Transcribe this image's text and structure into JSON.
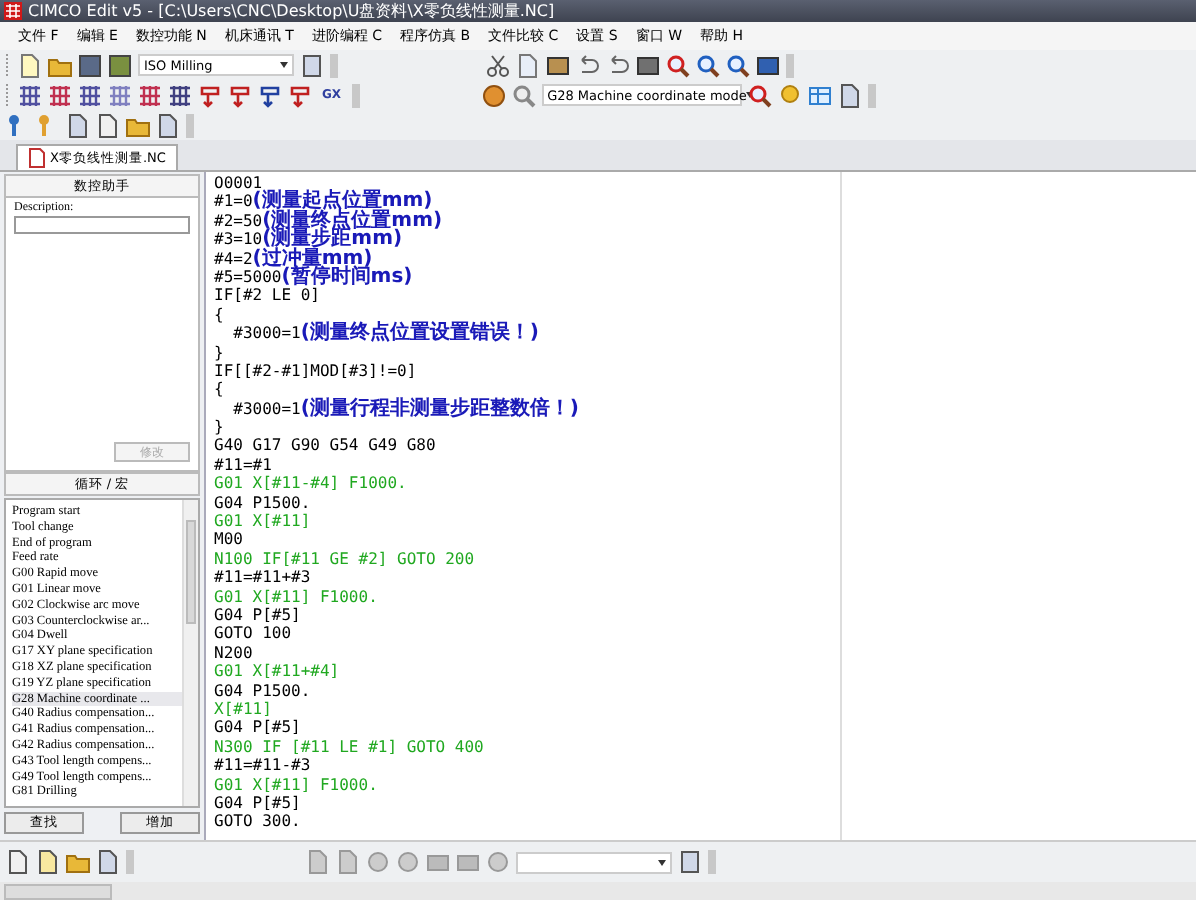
{
  "window": {
    "title": "CIMCO Edit v5 - [C:\\Users\\CNC\\Desktop\\U盘资料\\X零负线性测量.NC]"
  },
  "menu": [
    "文件 F",
    "编辑 E",
    "数控功能 N",
    "机床通讯 T",
    "进阶编程 C",
    "程序仿真 B",
    "文件比较 C",
    "设置 S",
    "窗口 W",
    "帮助 H"
  ],
  "toolbar": {
    "machine_combo": "ISO Milling",
    "gx_button": "GX",
    "mode_combo": "G28 Machine coordinate mode"
  },
  "tabs": [
    {
      "label": "X零负线性测量.NC",
      "selected": true
    }
  ],
  "assistant": {
    "title": "数控助手",
    "description_label": "Description:",
    "modify_button": "修改",
    "modify_disabled": true
  },
  "cycles": {
    "title": "循环 / 宏",
    "items": [
      {
        "label": "Program start",
        "selected": false
      },
      {
        "label": "Tool change",
        "selected": false
      },
      {
        "label": "End of program",
        "selected": false
      },
      {
        "label": "Feed rate",
        "selected": false
      },
      {
        "label": "G00 Rapid move",
        "selected": false
      },
      {
        "label": "G01 Linear move",
        "selected": false
      },
      {
        "label": "G02 Clockwise arc move",
        "selected": false
      },
      {
        "label": "G03 Counterclockwise ar...",
        "selected": false
      },
      {
        "label": "G04 Dwell",
        "selected": false
      },
      {
        "label": "G17 XY plane specification",
        "selected": false
      },
      {
        "label": "G18 XZ plane specification",
        "selected": false
      },
      {
        "label": "G19 YZ plane specification",
        "selected": false
      },
      {
        "label": "G28 Machine coordinate ...",
        "selected": true
      },
      {
        "label": "G40 Radius compensation...",
        "selected": false
      },
      {
        "label": "G41 Radius compensation...",
        "selected": false
      },
      {
        "label": "G42 Radius compensation...",
        "selected": false
      },
      {
        "label": "G43 Tool length compens...",
        "selected": false
      },
      {
        "label": "G49 Tool length compens...",
        "selected": false
      },
      {
        "label": "G81 Drilling",
        "selected": false
      }
    ],
    "buttons": [
      "查找",
      "增加"
    ]
  },
  "code": [
    {
      "segments": [
        {
          "kind": "plain",
          "text": "O0001"
        }
      ]
    },
    {
      "segments": [
        {
          "kind": "plain",
          "text": "#1=0"
        },
        {
          "kind": "comment",
          "text": "(测量起点位置mm)"
        }
      ]
    },
    {
      "segments": [
        {
          "kind": "plain",
          "text": "#2=50"
        },
        {
          "kind": "comment",
          "text": "(测量终点位置mm)"
        }
      ]
    },
    {
      "segments": [
        {
          "kind": "plain",
          "text": "#3=10"
        },
        {
          "kind": "comment",
          "text": "(测量步距mm)"
        }
      ]
    },
    {
      "segments": [
        {
          "kind": "plain",
          "text": "#4=2"
        },
        {
          "kind": "comment",
          "text": "(过冲量mm)"
        }
      ]
    },
    {
      "segments": [
        {
          "kind": "plain",
          "text": "#5=5000"
        },
        {
          "kind": "comment",
          "text": "(暂停时间ms)"
        }
      ]
    },
    {
      "segments": [
        {
          "kind": "plain",
          "text": "IF[#2 LE 0]"
        }
      ]
    },
    {
      "segments": [
        {
          "kind": "plain",
          "text": "{"
        }
      ]
    },
    {
      "segments": [
        {
          "kind": "plain",
          "text": "  #3000=1"
        },
        {
          "kind": "comment",
          "text": "(测量终点位置设置错误！)"
        }
      ]
    },
    {
      "segments": [
        {
          "kind": "plain",
          "text": "}"
        }
      ]
    },
    {
      "segments": [
        {
          "kind": "plain",
          "text": "IF[[#2-#1]MOD[#3]!=0]"
        }
      ]
    },
    {
      "segments": [
        {
          "kind": "plain",
          "text": "{"
        }
      ]
    },
    {
      "segments": [
        {
          "kind": "plain",
          "text": "  #3000=1"
        },
        {
          "kind": "comment",
          "text": "(测量行程非测量步距整数倍！)"
        }
      ]
    },
    {
      "segments": [
        {
          "kind": "plain",
          "text": "}"
        }
      ]
    },
    {
      "segments": [
        {
          "kind": "plain",
          "text": "G40 G17 G90 G54 G49 G80"
        }
      ]
    },
    {
      "segments": [
        {
          "kind": "plain",
          "text": "#11=#1"
        }
      ]
    },
    {
      "segments": [
        {
          "kind": "motion",
          "text": "G01 X[#11-#4] F1000."
        }
      ]
    },
    {
      "segments": [
        {
          "kind": "plain",
          "text": "G04 P1500."
        }
      ]
    },
    {
      "segments": [
        {
          "kind": "motion",
          "text": "G01 X[#11]"
        }
      ]
    },
    {
      "segments": [
        {
          "kind": "plain",
          "text": "M00"
        }
      ]
    },
    {
      "segments": [
        {
          "kind": "motion",
          "text": "N100 IF[#11 GE #2] GOTO 200"
        }
      ]
    },
    {
      "segments": [
        {
          "kind": "plain",
          "text": "#11=#11+#3"
        }
      ]
    },
    {
      "segments": [
        {
          "kind": "motion",
          "text": "G01 X[#11] F1000."
        }
      ]
    },
    {
      "segments": [
        {
          "kind": "plain",
          "text": "G04 P[#5]"
        }
      ]
    },
    {
      "segments": [
        {
          "kind": "plain",
          "text": "GOTO 100"
        }
      ]
    },
    {
      "segments": [
        {
          "kind": "plain",
          "text": "N200"
        }
      ]
    },
    {
      "segments": [
        {
          "kind": "motion",
          "text": "G01 X[#11+#4]"
        }
      ]
    },
    {
      "segments": [
        {
          "kind": "plain",
          "text": "G04 P1500."
        }
      ]
    },
    {
      "segments": [
        {
          "kind": "motion",
          "text": "X[#11]"
        }
      ]
    },
    {
      "segments": [
        {
          "kind": "plain",
          "text": "G04 P[#5]"
        }
      ]
    },
    {
      "segments": [
        {
          "kind": "motion",
          "text": "N300 IF [#11 LE #1] GOTO 400"
        }
      ]
    },
    {
      "segments": [
        {
          "kind": "plain",
          "text": "#11=#11-#3"
        }
      ]
    },
    {
      "segments": [
        {
          "kind": "motion",
          "text": "G01 X[#11] F1000."
        }
      ]
    },
    {
      "segments": [
        {
          "kind": "plain",
          "text": "G04 P[#5]"
        }
      ]
    },
    {
      "segments": [
        {
          "kind": "plain",
          "text": "GOTO 300."
        }
      ]
    }
  ]
}
